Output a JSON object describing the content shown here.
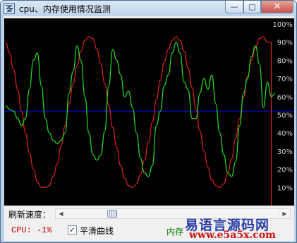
{
  "window": {
    "title": "cpu、内存使用情况监测"
  },
  "controls": {
    "min": "—",
    "max": "▢",
    "close": "✕"
  },
  "chart_data": {
    "type": "line",
    "ylim": [
      0,
      100
    ],
    "grid": false,
    "background": "#000000",
    "yticks": [
      "100%",
      "90%",
      "80%",
      "70%",
      "60%",
      "50%",
      "40%",
      "30%",
      "20%",
      "10%"
    ],
    "reference_line": {
      "value": 52,
      "color": "#0000ff"
    },
    "series": [
      {
        "color": "#e02020",
        "values": [
          90,
          84,
          75,
          64,
          52,
          40,
          29,
          20,
          13,
          10,
          10,
          11,
          16,
          23,
          33,
          44,
          56,
          67,
          77,
          85,
          91,
          93,
          92,
          86,
          78,
          67,
          55,
          43,
          32,
          22,
          15,
          11,
          10,
          12,
          17,
          25,
          35,
          46,
          58,
          69,
          79,
          86,
          91,
          93,
          91,
          85,
          76,
          65,
          53,
          41,
          30,
          21,
          14,
          11,
          10,
          12,
          18,
          26,
          37,
          48,
          60,
          71,
          80,
          87,
          92,
          93,
          90,
          0
        ]
      },
      {
        "color": "#20e020",
        "values": [
          55,
          53,
          52,
          48,
          44,
          48,
          64,
          80,
          84,
          66,
          48,
          40,
          36,
          34,
          36,
          40,
          62,
          74,
          88,
          80,
          60,
          40,
          28,
          25,
          28,
          41,
          66,
          86,
          80,
          72,
          60,
          63,
          54,
          40,
          26,
          18,
          16,
          22,
          44,
          52,
          66,
          72,
          84,
          90,
          84,
          68,
          64,
          48,
          48,
          62,
          70,
          64,
          72,
          56,
          40,
          28,
          18,
          16,
          24,
          44,
          62,
          70,
          82,
          88,
          78,
          54,
          68,
          60,
          62
        ]
      }
    ]
  },
  "speed": {
    "label": "刷新速度：",
    "value": 0.2
  },
  "status": {
    "cpu": "CPU: -1%",
    "smooth_label": "平滑曲线",
    "smooth_checked": "✓",
    "memory": "内存"
  },
  "watermark": {
    "title": "易语言源码网",
    "url": "www.e5a5x.com"
  }
}
